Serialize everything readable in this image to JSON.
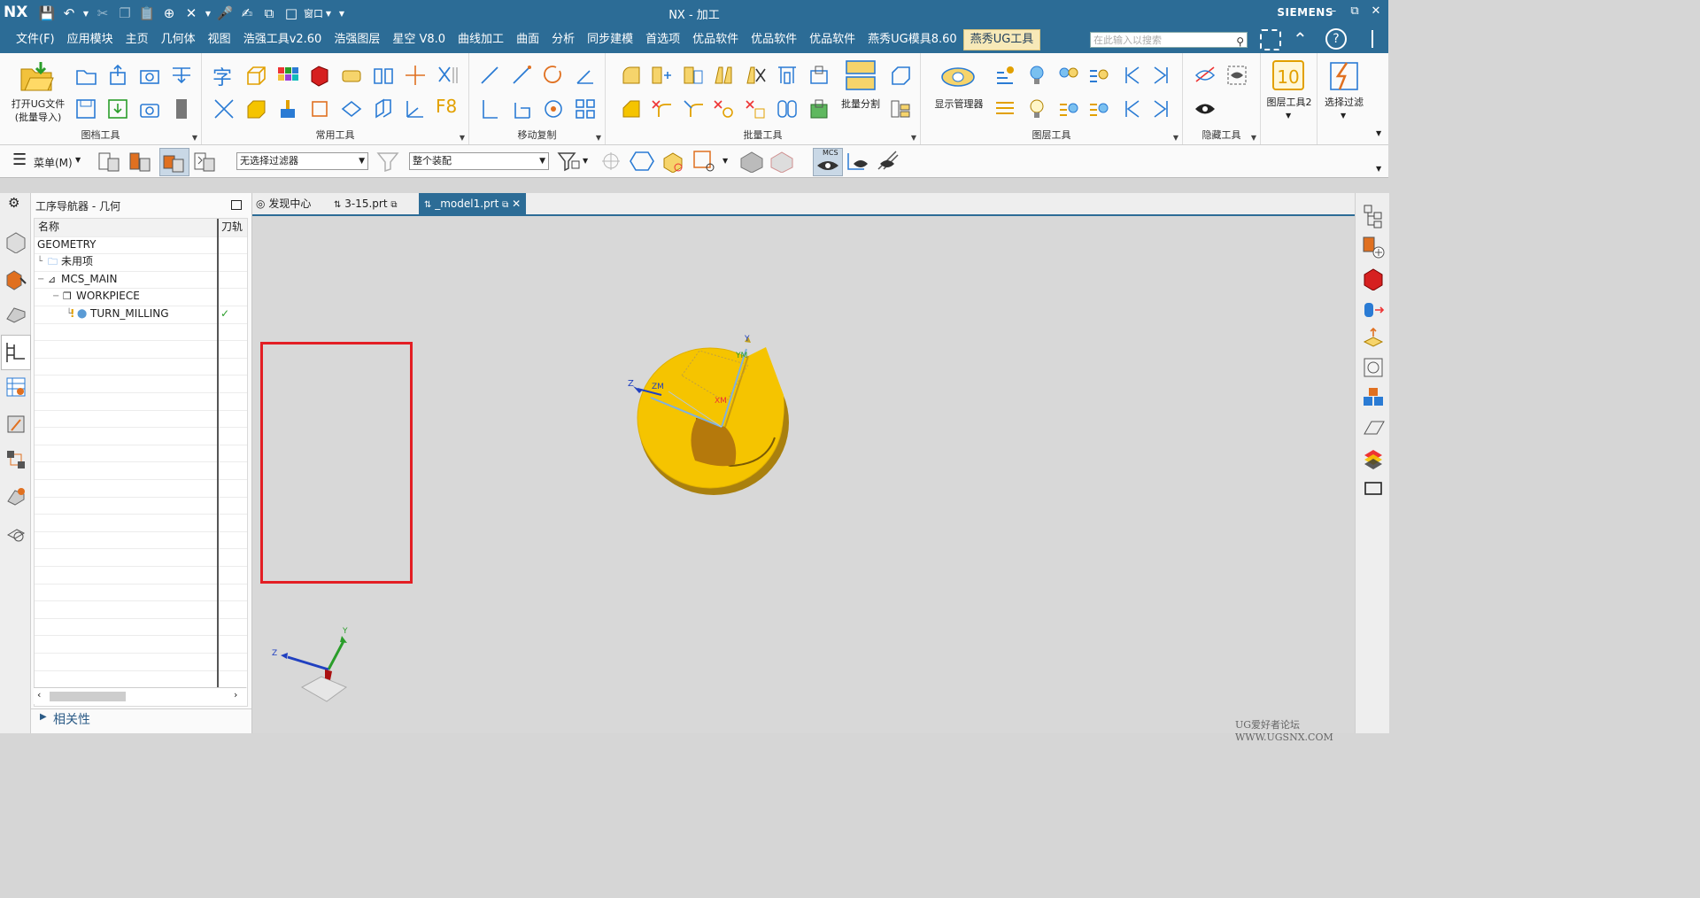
{
  "titlebar": {
    "logo": "NX",
    "window_title": "NX - 加工",
    "brand": "SIEMENS",
    "window_menu_label": "窗口"
  },
  "menu": {
    "items": [
      "文件(F)",
      "应用模块",
      "主页",
      "几何体",
      "视图",
      "浩强工具v2.60",
      "浩强图层",
      "星空 V8.0",
      "曲线加工",
      "曲面",
      "分析",
      "同步建模",
      "首选项",
      "优品软件",
      "优品软件",
      "优品软件",
      "燕秀UG模具8.60",
      "燕秀UG工具"
    ],
    "active": "燕秀UG工具",
    "search_placeholder": "在此输入以搜索"
  },
  "ribbon": {
    "open_ug_label_line1": "打开UG文件",
    "open_ug_label_line2": "(批量导入)",
    "groups": {
      "g1": "图档工具",
      "g2": "常用工具",
      "g3": "移动复制",
      "g4": "批量工具",
      "g5": "图层工具",
      "g6": "隐藏工具"
    },
    "batch_split_label": "批量分割",
    "display_manager_label": "显示管理器",
    "layer_tool2_label": "图层工具2",
    "layer_tool2_number": "10",
    "select_filter_label": "选择过滤",
    "char_label": "字",
    "f8_label": "F8"
  },
  "toolbar2": {
    "menu_label": "菜单(M)",
    "filter_value": "无选择过滤器",
    "assembly_value": "整个装配",
    "mcs_label": "MCS"
  },
  "navigator": {
    "title": "工序导航器 - 几何",
    "col_name": "名称",
    "col_path": "刀轨",
    "rows": [
      {
        "label": "GEOMETRY",
        "level": 0,
        "icon": "",
        "status": ""
      },
      {
        "label": "未用项",
        "level": 1,
        "icon": "folder-icon",
        "status": ""
      },
      {
        "label": "MCS_MAIN",
        "level": 1,
        "icon": "mcs-icon",
        "status": ""
      },
      {
        "label": "WORKPIECE",
        "level": 2,
        "icon": "workpiece-icon",
        "status": ""
      },
      {
        "label": "TURN_MILLING",
        "level": 3,
        "icon": "operation-icon",
        "status": "✓"
      }
    ],
    "related_label": "相关性"
  },
  "tabs": [
    {
      "label": "发现中心",
      "active": false
    },
    {
      "label": "3-15.prt",
      "active": false
    },
    {
      "label": "_model1.prt",
      "active": true
    }
  ],
  "viewport": {
    "axis_labels": {
      "x": "XM",
      "y": "Y",
      "ym": "YM",
      "z": "Z",
      "zm": "ZM"
    },
    "triad": {
      "y": "Y",
      "z": "Z"
    }
  },
  "watermark": "UG爱好者论坛 WWW.UGSNX.COM",
  "colors": {
    "accent": "#2c6c96",
    "part": "#f5c400",
    "highlight_box": "#e31e24"
  }
}
